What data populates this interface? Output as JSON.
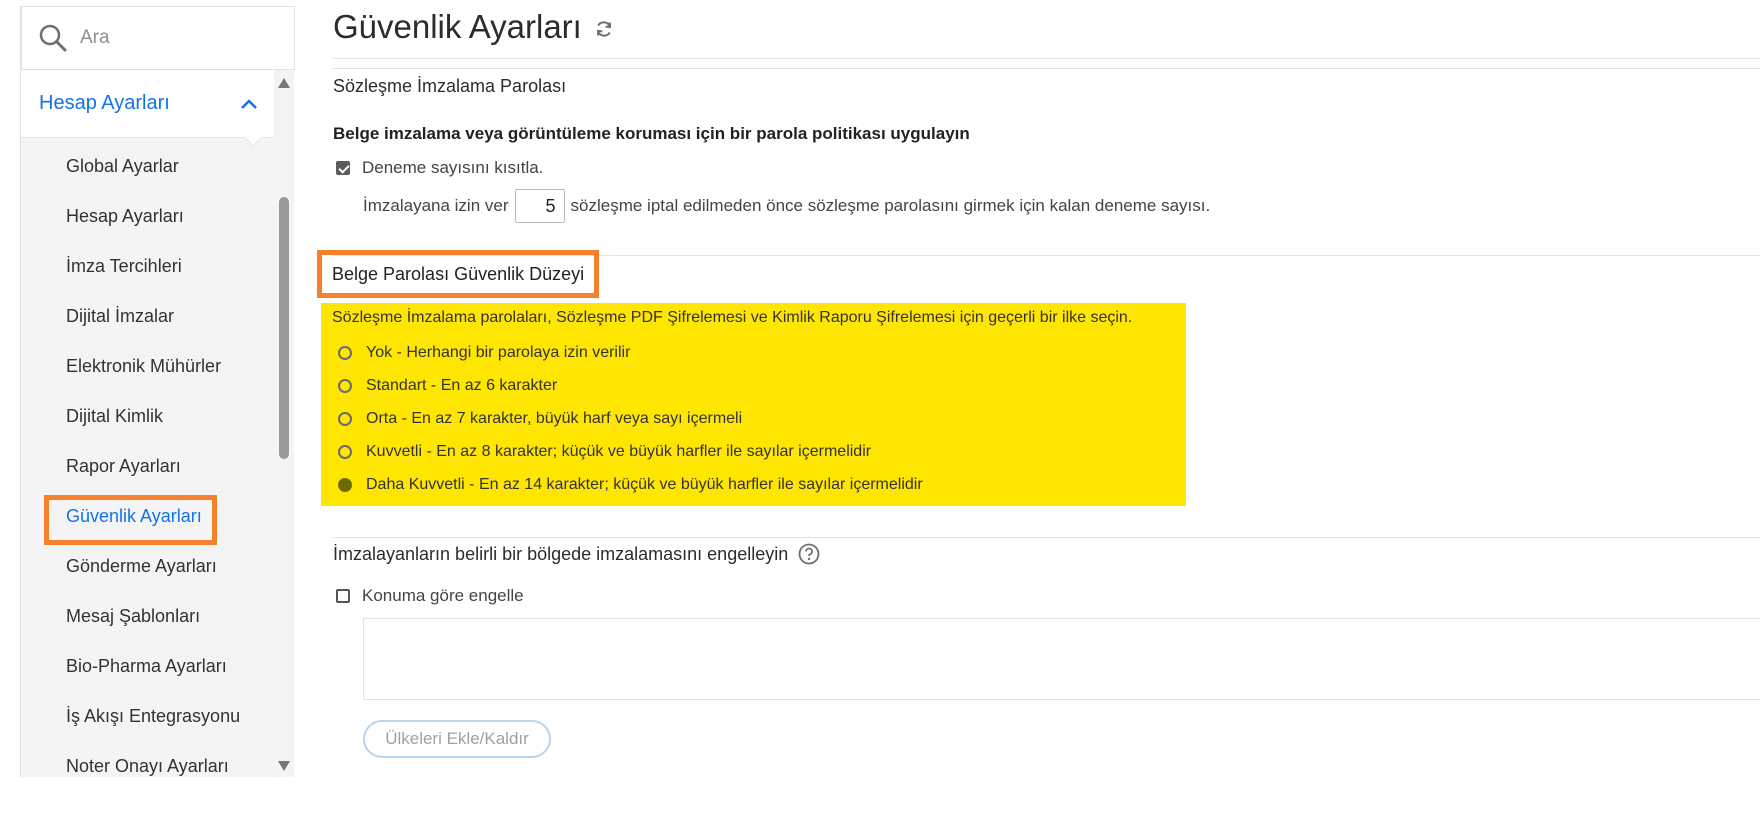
{
  "sidebar": {
    "search_placeholder": "Ara",
    "group_label": "Hesap Ayarları",
    "items": [
      {
        "label": "Global Ayarlar"
      },
      {
        "label": "Hesap Ayarları"
      },
      {
        "label": "İmza Tercihleri"
      },
      {
        "label": "Dijital İmzalar"
      },
      {
        "label": "Elektronik Mühürler"
      },
      {
        "label": "Dijital Kimlik"
      },
      {
        "label": "Rapor Ayarları"
      },
      {
        "label": "Güvenlik Ayarları",
        "active": true
      },
      {
        "label": "Gönderme Ayarları"
      },
      {
        "label": "Mesaj Şablonları"
      },
      {
        "label": "Bio-Pharma Ayarları"
      },
      {
        "label": "İş Akışı Entegrasyonu"
      },
      {
        "label": "Noter Onayı Ayarları"
      }
    ]
  },
  "main": {
    "title": "Güvenlik Ayarları",
    "contract_password": {
      "title": "Sözleşme İmzalama Parolası",
      "policy_text": "Belge imzalama veya görüntüleme koruması için bir parola politikası uygulayın",
      "limit_checkbox_label": "Deneme sayısını kısıtla.",
      "limit_checked": true,
      "attempts_prefix": "İmzalayana izin ver",
      "attempts_value": "5",
      "attempts_suffix": "sözleşme iptal edilmeden önce sözleşme parolasını girmek için kalan deneme sayısı."
    },
    "security_level": {
      "title": "Belge Parolası Güvenlik Düzeyi",
      "description": "Sözleşme İmzalama parolaları, Sözleşme PDF Şifrelemesi ve Kimlik Raporu Şifrelemesi için geçerli bir ilke seçin.",
      "options": [
        {
          "label": "Yok - Herhangi bir parolaya izin verilir",
          "selected": false
        },
        {
          "label": "Standart - En az 6 karakter",
          "selected": false
        },
        {
          "label": "Orta - En az 7 karakter, büyük harf veya sayı içermeli",
          "selected": false
        },
        {
          "label": "Kuvvetli - En az 8 karakter; küçük ve büyük harfler ile sayılar içermelidir",
          "selected": false
        },
        {
          "label": "Daha Kuvvetli - En az 14 karakter; küçük ve büyük harfler ile sayılar içermelidir",
          "selected": true
        }
      ]
    },
    "region_block": {
      "title": "İmzalayanların belirli bir bölgede imzalamasını engelleyin",
      "checkbox_label": "Konuma göre engelle",
      "checked": false,
      "button_label": "Ülkeleri Ekle/Kaldır"
    }
  },
  "colors": {
    "accent": "#1473e6",
    "highlight_border": "#f5812c",
    "highlight_fill": "#ffe600"
  }
}
